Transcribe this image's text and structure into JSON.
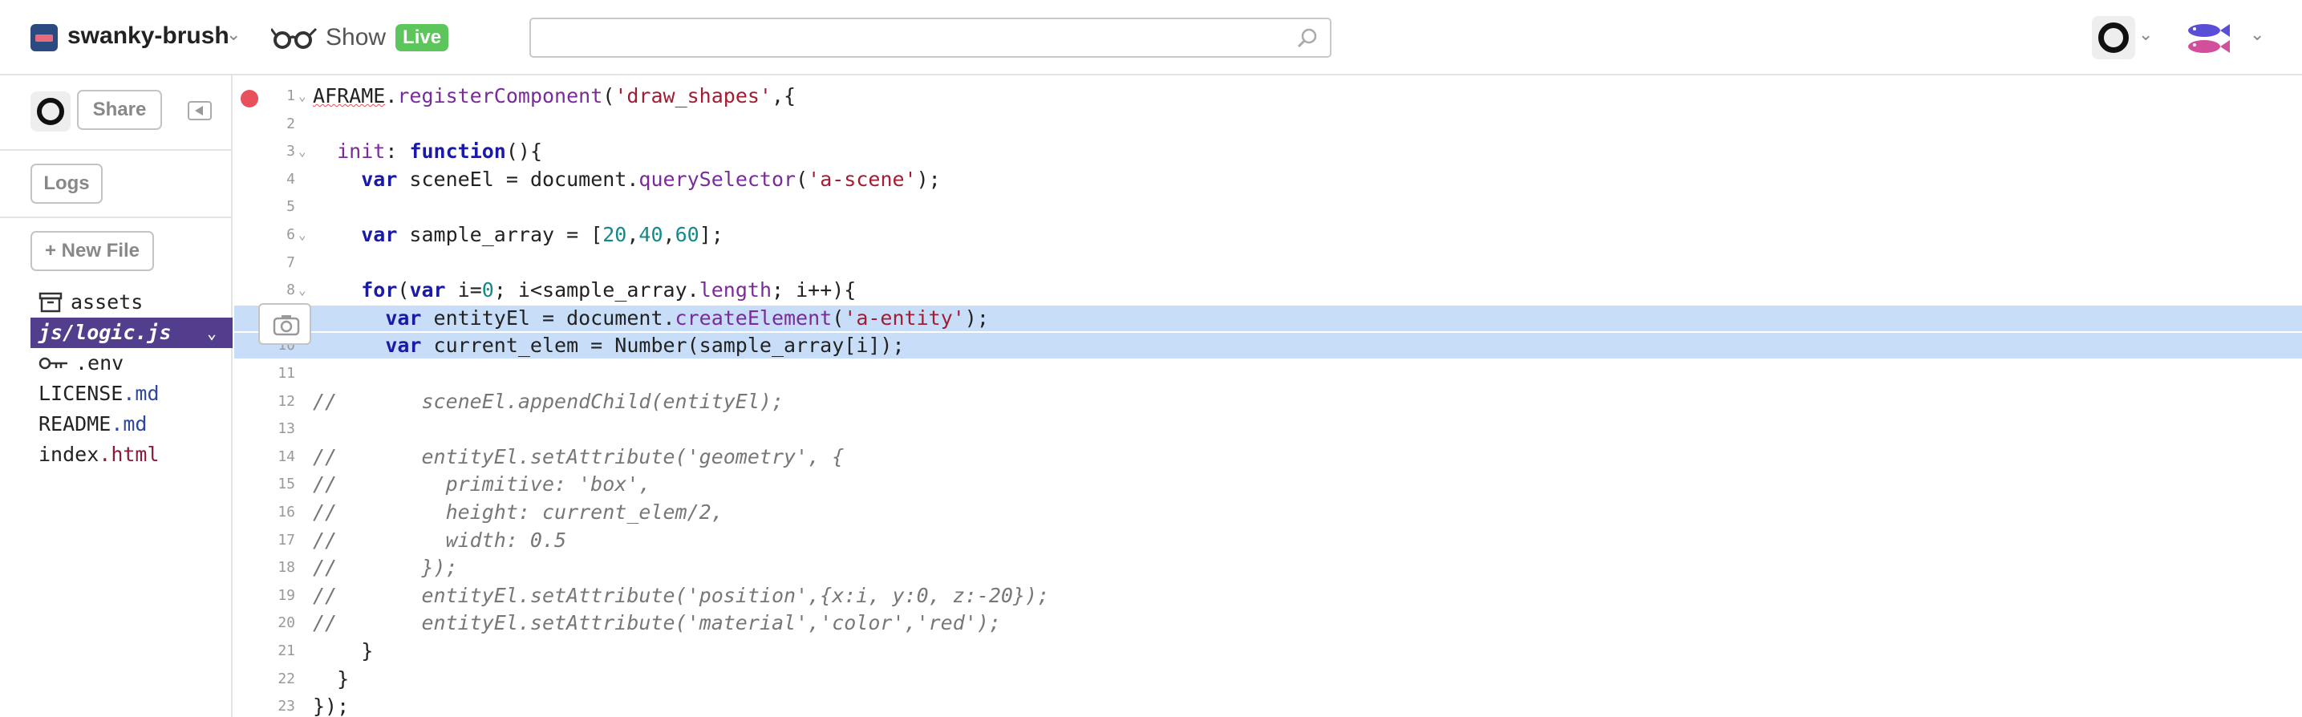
{
  "header": {
    "project_name": "swanky-brush",
    "show_label": "Show",
    "live_badge": "Live",
    "search_placeholder": "",
    "project_logo_colors": {
      "background": "#2b4a82",
      "stripe": "#e86a7c"
    },
    "live_color": "#5cc55c"
  },
  "sidebar": {
    "share_label": "Share",
    "logs_label": "Logs",
    "new_file_label": "+ New File",
    "active_color": "#523e8c",
    "files": [
      {
        "icon": "archive-icon",
        "name": "assets",
        "ext": ""
      },
      {
        "name": "js/logic.js",
        "ext": "",
        "active": true
      },
      {
        "icon": "key-icon",
        "name": ".env",
        "ext": ""
      },
      {
        "name": "LICENSE",
        "ext": ".md"
      },
      {
        "name": "README",
        "ext": ".md"
      },
      {
        "name": "index",
        "ext": ".html"
      }
    ]
  },
  "editor": {
    "highlight_color": "#c8ddf7",
    "error_line": 1,
    "highlighted_lines": [
      9,
      10
    ],
    "lines": [
      {
        "n": "1",
        "fold": true,
        "text": "AFRAME.registerComponent('draw_shapes',{"
      },
      {
        "n": "2",
        "text": ""
      },
      {
        "n": "3",
        "fold": true,
        "text": "  init: function(){"
      },
      {
        "n": "4",
        "text": "    var sceneEl = document.querySelector('a-scene');"
      },
      {
        "n": "5",
        "text": ""
      },
      {
        "n": "6",
        "fold": true,
        "text": "    var sample_array = [20,40,60];"
      },
      {
        "n": "7",
        "text": ""
      },
      {
        "n": "8",
        "fold": true,
        "text": "    for(var i=0; i<sample_array.length; i++){"
      },
      {
        "n": "9",
        "text": "      var entityEl = document.createElement('a-entity');"
      },
      {
        "n": "10",
        "text": "      var current_elem = Number(sample_array[i]);"
      },
      {
        "n": "11",
        "text": ""
      },
      {
        "n": "12",
        "text": "//       sceneEl.appendChild(entityEl);"
      },
      {
        "n": "13",
        "text": ""
      },
      {
        "n": "14",
        "text": "//       entityEl.setAttribute('geometry', {"
      },
      {
        "n": "15",
        "text": "//         primitive: 'box',"
      },
      {
        "n": "16",
        "text": "//         height: current_elem/2,"
      },
      {
        "n": "17",
        "text": "//         width: 0.5"
      },
      {
        "n": "18",
        "text": "//       });"
      },
      {
        "n": "19",
        "text": "//       entityEl.setAttribute('position',{x:i, y:0, z:-20});"
      },
      {
        "n": "20",
        "text": "//       entityEl.setAttribute('material','color','red');"
      },
      {
        "n": "21",
        "text": "    }"
      },
      {
        "n": "22",
        "text": "  }"
      },
      {
        "n": "23",
        "text": "});"
      }
    ]
  }
}
